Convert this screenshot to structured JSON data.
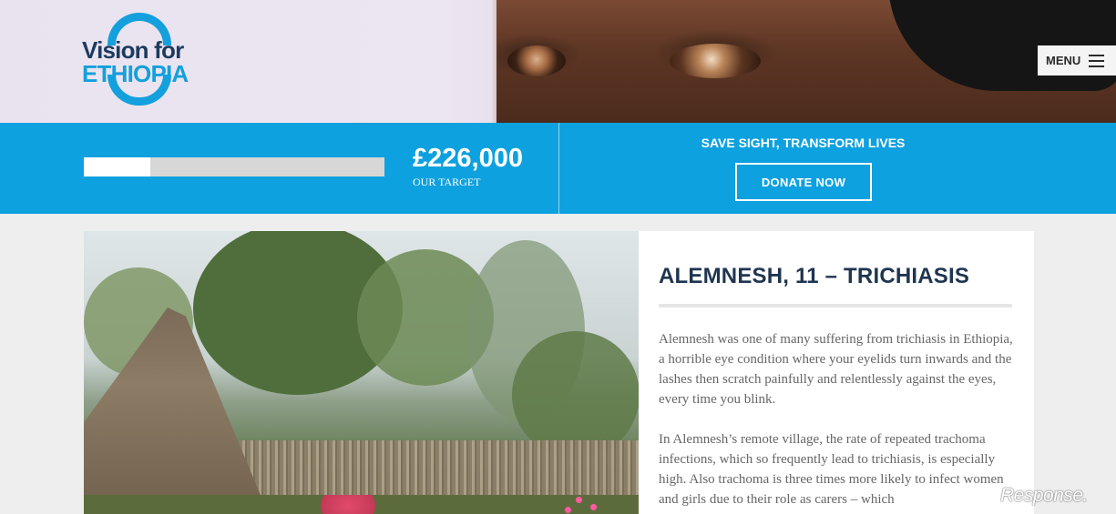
{
  "header": {
    "logo": {
      "line1": "Vision for",
      "line2": "ETHIOPIA"
    },
    "menu_label": "MENU"
  },
  "fundraising": {
    "progress_fraction": 0.22,
    "amount": "£226,000",
    "target_label": "OUR TARGET",
    "tagline": "SAVE SIGHT, TRANSFORM LIVES",
    "donate_label": "DONATE NOW"
  },
  "article": {
    "title": "ALEMNESH, 11 – TRICHIASIS",
    "paragraphs": [
      "Alemnesh was one of many suffering from trichiasis in Ethiopia, a horrible eye condition where your eyelids turn inwards and the lashes then scratch painfully and relentlessly against the eyes, every time you blink.",
      "In Alemnesh’s remote village, the rate of repeated trachoma infections, which so frequently lead to trichiasis, is especially high. Also trachoma is three times more likely to infect women and girls due to their role as carers – which"
    ]
  },
  "watermark": "Response.",
  "colors": {
    "brand_blue": "#0ea1df",
    "navy": "#1c3b5e",
    "page_bg": "#eeeeee"
  },
  "icons": [
    "hamburger-menu-icon"
  ]
}
